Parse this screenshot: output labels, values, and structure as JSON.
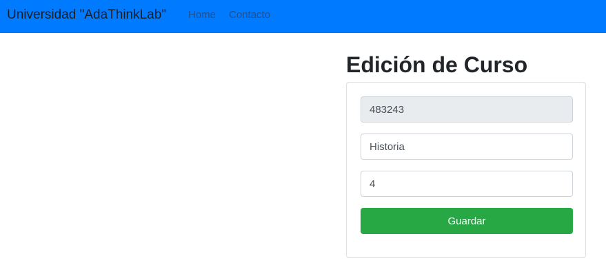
{
  "navbar": {
    "brand": "Universidad \"AdaThinkLab\"",
    "links": [
      {
        "label": "Home"
      },
      {
        "label": "Contacto"
      }
    ],
    "background_color": "#007bff"
  },
  "main": {
    "title": "Edición de Curso",
    "form": {
      "course_id": "483243",
      "course_name": "Historia",
      "credits": "4",
      "save_label": "Guardar",
      "save_color": "#28a745"
    }
  }
}
